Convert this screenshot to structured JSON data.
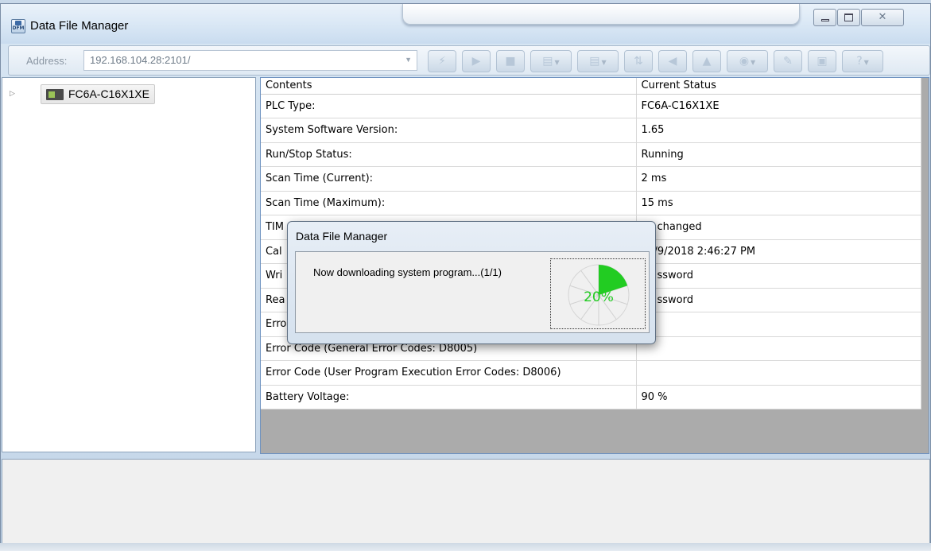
{
  "window": {
    "title": "Data File Manager"
  },
  "address": {
    "label": "Address:",
    "value": "192.168.104.28:2101/"
  },
  "toolbar": {
    "buttons": [
      {
        "icon": "lightning-icon"
      },
      {
        "icon": "run-icon"
      },
      {
        "icon": "stop-icon"
      },
      {
        "icon": "upload-icon",
        "dropdown": true
      },
      {
        "icon": "download-icon",
        "dropdown": true
      },
      {
        "icon": "transfer-icon"
      },
      {
        "icon": "back-icon"
      },
      {
        "icon": "up-icon"
      },
      {
        "icon": "globe-icon",
        "dropdown": true
      },
      {
        "icon": "edit-document-icon"
      },
      {
        "icon": "save-document-icon"
      },
      {
        "icon": "help-icon",
        "dropdown": true
      }
    ]
  },
  "tree": {
    "node_label": "FC6A-C16X1XE"
  },
  "grid": {
    "headers": [
      "Contents",
      "Current Status"
    ],
    "rows": [
      [
        "PLC Type:",
        "FC6A-C16X1XE"
      ],
      [
        "System Software Version:",
        "1.65"
      ],
      [
        "Run/Stop Status:",
        "Running"
      ],
      [
        "Scan Time (Current):",
        "2 ms"
      ],
      [
        "Scan Time (Maximum):",
        "15 ms"
      ],
      [
        "TIM",
        "changed"
      ],
      [
        "Cal",
        "/9/2018 2:46:27 PM"
      ],
      [
        "Wri",
        "ssword"
      ],
      [
        "Rea",
        "ssword"
      ],
      [
        "Erro",
        ""
      ],
      [
        "Error Code (General Error Codes: D8005)",
        ""
      ],
      [
        "Error Code (User Program Execution Error Codes: D8006)",
        ""
      ],
      [
        "Battery Voltage:",
        "90 %"
      ]
    ]
  },
  "dialog": {
    "title": "Data File Manager",
    "message": "Now downloading system program...(1/1)",
    "progress_text": "20%",
    "progress_fraction": 0.2,
    "progress_color": "#22cc22"
  }
}
